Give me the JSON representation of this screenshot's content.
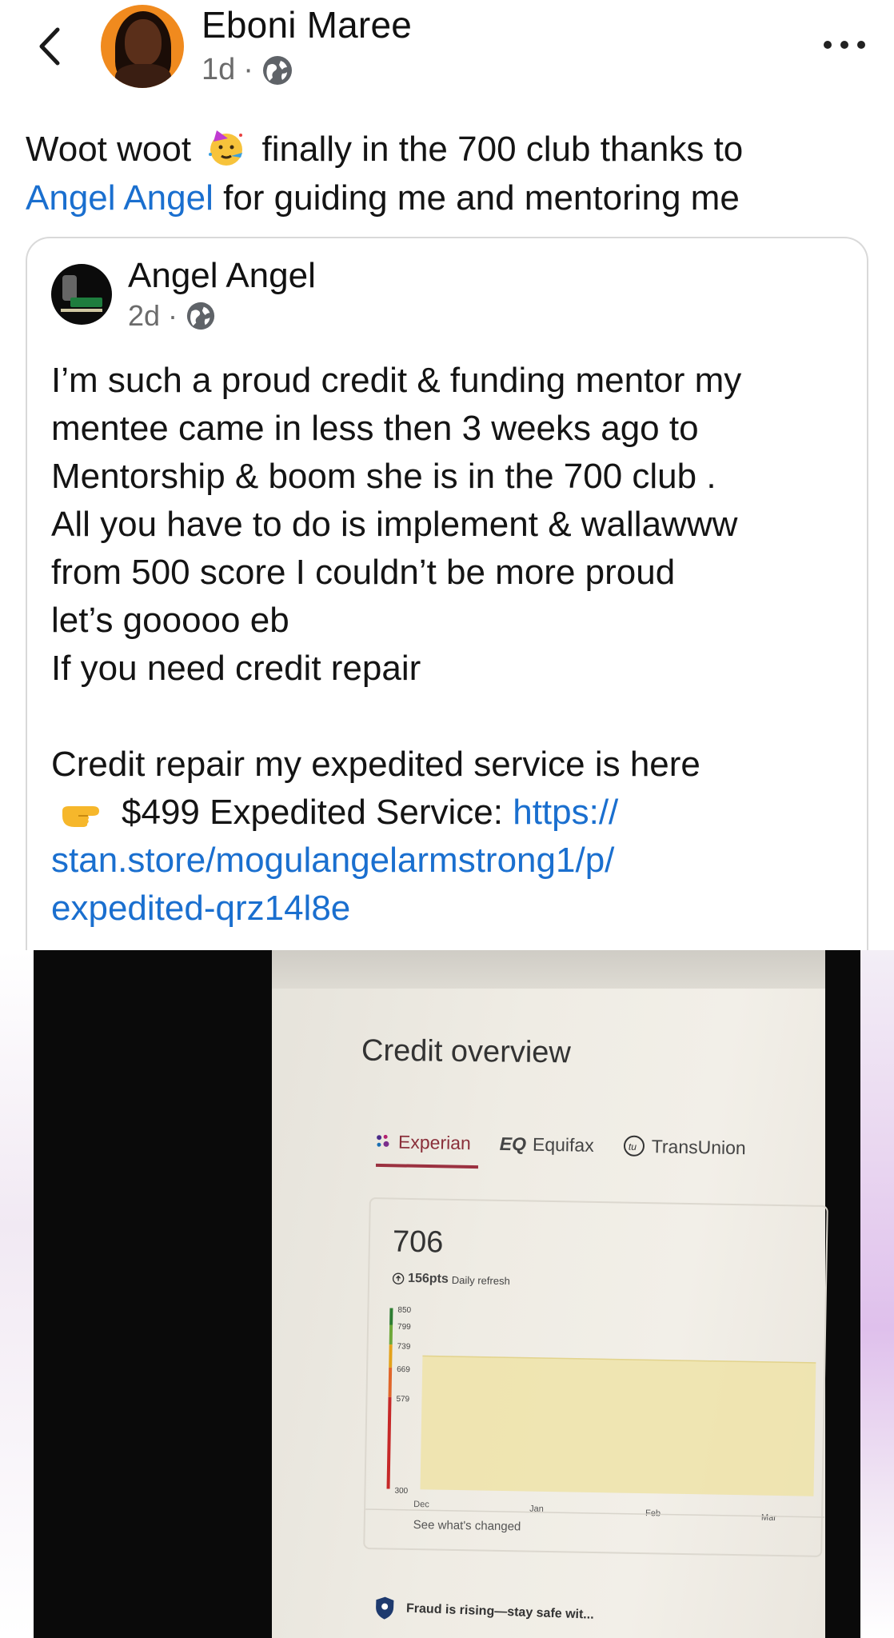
{
  "header": {
    "author": "Eboni Maree",
    "time": "1d",
    "dot": "·"
  },
  "post": {
    "text_before": "Woot woot",
    "text_after": "finally in the 700 club thanks to",
    "mention": "Angel Angel",
    "text_end": "for guiding me and mentoring me"
  },
  "shared": {
    "author": "Angel Angel",
    "time": "2d",
    "dot": "·",
    "lines": [
      "I’m such a proud credit & funding mentor my",
      "mentee came in less then 3 weeks ago to",
      "Mentorship & boom she is in the 700 club .",
      "All you have to do is implement & wallawww",
      "from 500 score I couldn’t be more proud",
      "let’s gooooo eb",
      "If you need credit repair"
    ],
    "service_line": "Credit repair my expedited service is here",
    "price_line": "$499 Expedited Service:",
    "link_part1": "https://",
    "link_part2": "stan.store/mogulangelarmstrong1/p/",
    "link_part3": "expedited-qrz14l8e"
  },
  "photo": {
    "title": "Credit overview",
    "tabs": [
      "Experian",
      "Equifax",
      "TransUnion"
    ],
    "active_tab": "Experian",
    "score": "706",
    "change": "156pts",
    "refresh": "Daily refresh",
    "see_changed": "See what's changed",
    "fraud": "Fraud is rising—stay safe wit..."
  },
  "chart_data": {
    "type": "area",
    "title": "",
    "xlabel": "",
    "ylabel": "",
    "categories": [
      "Dec",
      "Jan",
      "Feb",
      "Mar"
    ],
    "y_ticks": [
      850,
      799,
      739,
      669,
      579,
      300
    ],
    "ylim": [
      300,
      850
    ],
    "series": [
      {
        "values": [
          706,
          706,
          706,
          706
        ]
      }
    ],
    "colors": {
      "area": "#efe3a8",
      "band_excellent": "#2e7d32",
      "band_very_good": "#6ea83a",
      "band_good": "#e3a21b",
      "band_fair": "#e0662a",
      "band_poor": "#c62828"
    }
  }
}
